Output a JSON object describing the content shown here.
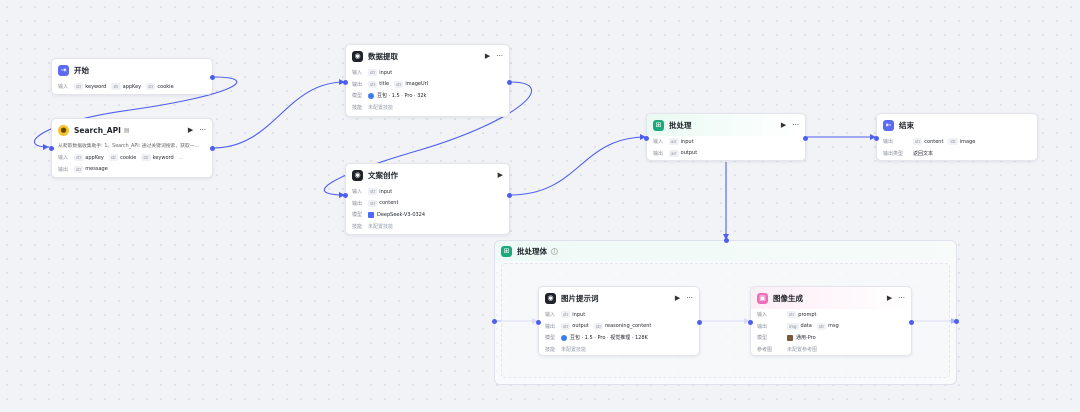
{
  "colors": {
    "accent": "#4e5ff0",
    "wire": "#4e5ff0"
  },
  "nodes": {
    "start": {
      "title": "开始",
      "icon": "start-icon",
      "input_label": "输入",
      "inputs": [
        "keyword",
        "appKey",
        "cookie"
      ]
    },
    "search_api": {
      "title": "Search_API",
      "icon": "plugin-icon",
      "desc": "从爬取数据收集助手: 1、Search_API: 通过关键词搜索，获取一...",
      "input_label": "输入",
      "inputs": [
        "appKey",
        "cookie",
        "keyword"
      ],
      "more": "...",
      "output_label": "输出",
      "outputs": [
        "message"
      ]
    },
    "extract": {
      "title": "数据提取",
      "icon": "llm-icon",
      "input_label": "输入",
      "inputs": [
        "input"
      ],
      "output_label": "输出",
      "outputs": [
        "title",
        "imageUrl"
      ],
      "model_label": "模型",
      "model": "豆包 · 1.5 · Pro · 32k",
      "skill_label": "技能",
      "skill": "未配置技能"
    },
    "copywriting": {
      "title": "文案创作",
      "icon": "llm-icon",
      "input_label": "输入",
      "inputs": [
        "input"
      ],
      "output_label": "输出",
      "outputs": [
        "content"
      ],
      "model_label": "模型",
      "model": "DeepSeek-V3-0324",
      "skill_label": "技能",
      "skill": "未配置技能"
    },
    "batch": {
      "title": "批处理",
      "icon": "batch-icon",
      "input_label": "输入",
      "inputs": [
        "input"
      ],
      "output_label": "输出",
      "outputs": [
        "output"
      ]
    },
    "end": {
      "title": "结束",
      "icon": "end-icon",
      "output_label": "输出",
      "outputs": [
        "content",
        "image"
      ],
      "mode_label": "输出类型",
      "mode": "返回文本"
    },
    "batch_body": {
      "title": "批处理体",
      "info": "i"
    },
    "prompt": {
      "title": "图片提示词",
      "icon": "llm-icon",
      "input_label": "输入",
      "inputs": [
        "input"
      ],
      "output_label": "输出",
      "outputs": [
        "output",
        "reasoning_content"
      ],
      "model_label": "模型",
      "model": "豆包 · 1.5 · Pro · 视觉推理 · 128K",
      "skill_label": "技能",
      "skill": "未配置技能"
    },
    "image_gen": {
      "title": "图像生成",
      "icon": "image-icon",
      "input_label": "输入",
      "inputs": [
        "prompt"
      ],
      "output_label": "输出",
      "outputs": [
        "data",
        "msg"
      ],
      "model_label": "模型",
      "model": "通用-Pro",
      "ref_label": "参考图",
      "ref": "未配置参考图"
    }
  },
  "actions": {
    "run": "▶",
    "more": "···"
  }
}
